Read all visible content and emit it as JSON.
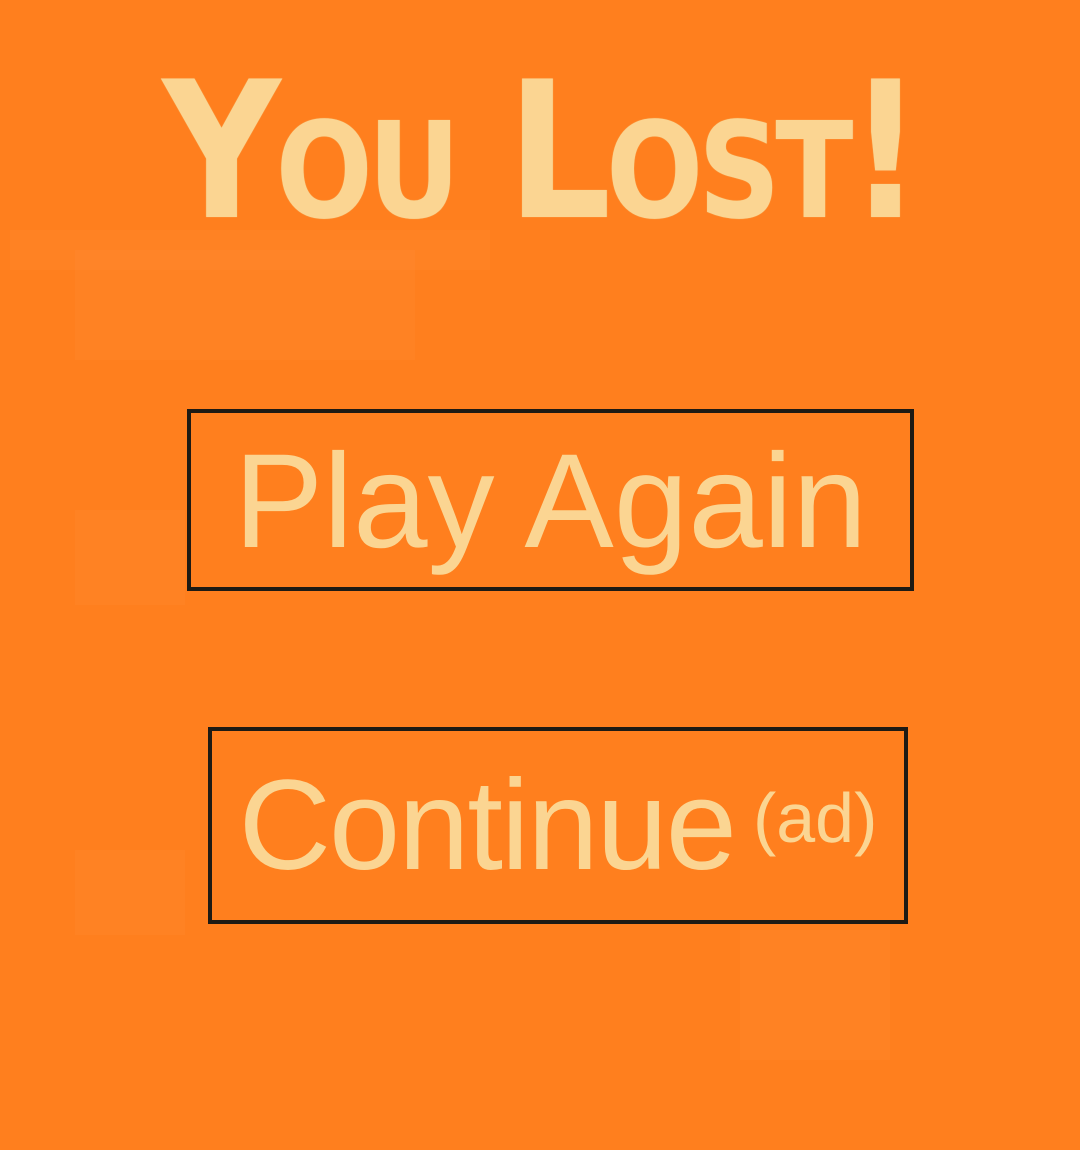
{
  "screen": {
    "background_color": "#ff7f1e",
    "text_color": "#fbd592"
  },
  "title": "You Lost!",
  "buttons": {
    "play_again": "Play Again",
    "continue": "Continue",
    "continue_note": "(ad)"
  }
}
